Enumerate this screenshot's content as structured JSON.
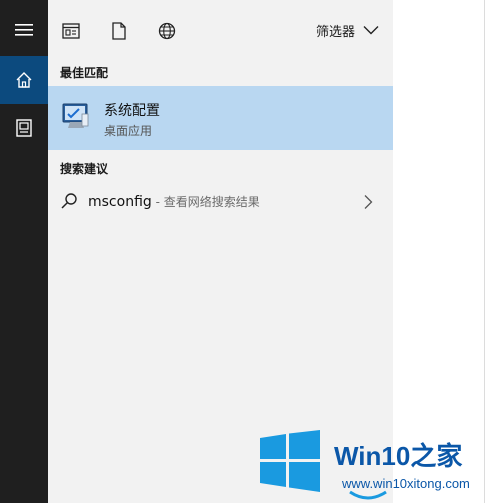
{
  "rail": {
    "items": [
      {
        "name": "hamburger-icon"
      },
      {
        "name": "home-icon"
      },
      {
        "name": "documents-icon"
      }
    ]
  },
  "toolbar": {
    "filter_label": "筛选器"
  },
  "best_match": {
    "section_label": "最佳匹配",
    "title": "系统配置",
    "subtitle": "桌面应用"
  },
  "search_suggestions": {
    "section_label": "搜索建议",
    "items": [
      {
        "query": "msconfig",
        "suffix": " - 查看网络搜索结果"
      }
    ]
  },
  "watermark": {
    "brand_win": "Win10",
    "brand_cn": "之家",
    "url": "www.win10xitong.com"
  },
  "colors": {
    "rail": "#1f1f1f",
    "rail_active": "#0c4a7e",
    "panel": "#f2f2f2",
    "selected": "#b9d7f1",
    "brand": "#0b57a8"
  }
}
